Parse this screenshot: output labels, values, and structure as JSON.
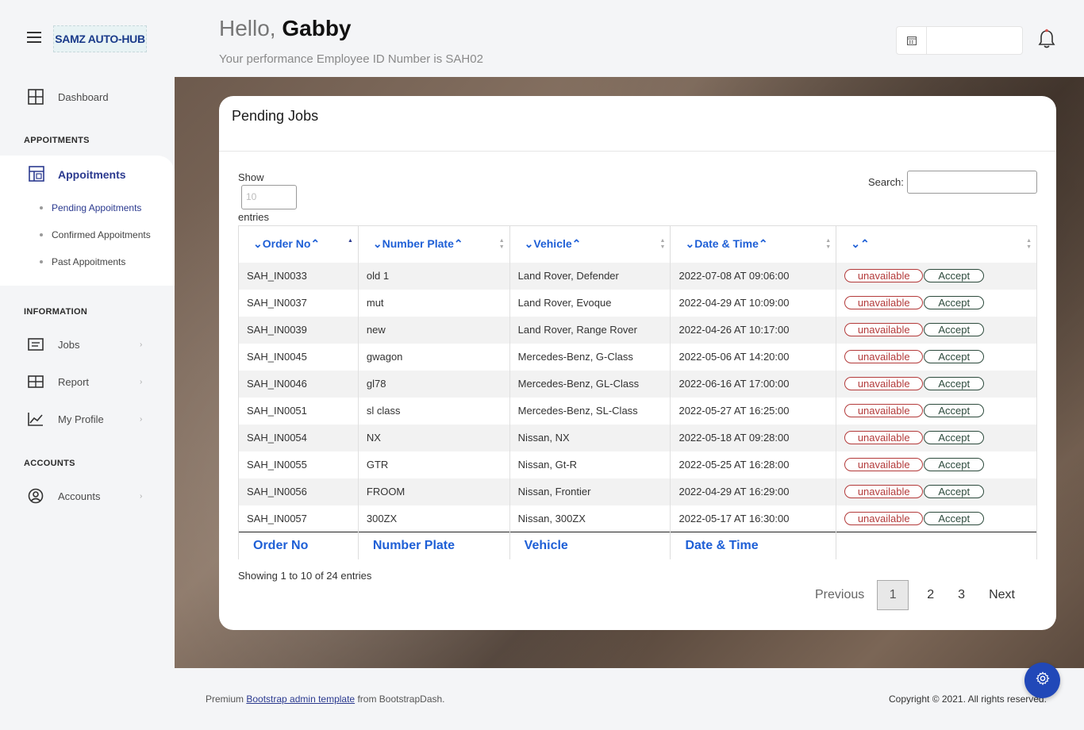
{
  "app": {
    "logo_text": "SAMZ AUTO-HUB"
  },
  "sidebar": {
    "dashboard_label": "Dashboard",
    "section_appointments": "APPOITMENTS",
    "appointments_label": "Appoitments",
    "sub_items": [
      "Pending Appoitments",
      "Confirmed Appoitments",
      "Past Appoitments"
    ],
    "section_information": "INFORMATION",
    "jobs_label": "Jobs",
    "report_label": "Report",
    "profile_label": "My Profile",
    "section_accounts": "ACCOUNTS",
    "accounts_label": "Accounts"
  },
  "header": {
    "greeting_prefix": "Hello,",
    "user_name": "Gabby",
    "subtitle": "Your performance Employee ID Number is SAH02",
    "date_value": ""
  },
  "card": {
    "title": "Pending Jobs",
    "show_label": "Show",
    "entries_placeholder": "10",
    "entries_label": "entries",
    "search_label": "Search:",
    "columns": [
      "Order No",
      "Number Plate",
      "Vehicle",
      "Date & Time",
      ""
    ],
    "footer_columns": [
      "Order No",
      "Number Plate",
      "Vehicle",
      "Date & Time",
      ""
    ],
    "unavailable_label": "unavailable",
    "accept_label": "Accept",
    "rows": [
      [
        "SAH_IN0033",
        "old 1",
        "Land Rover, Defender",
        "2022-07-08 AT 09:06:00"
      ],
      [
        "SAH_IN0037",
        "mut",
        "Land Rover, Evoque",
        "2022-04-29 AT 10:09:00"
      ],
      [
        "SAH_IN0039",
        "new",
        "Land Rover, Range Rover",
        "2022-04-26 AT 10:17:00"
      ],
      [
        "SAH_IN0045",
        "gwagon",
        "Mercedes-Benz, G-Class",
        "2022-05-06 AT 14:20:00"
      ],
      [
        "SAH_IN0046",
        "gl78",
        "Mercedes-Benz, GL-Class",
        "2022-06-16 AT 17:00:00"
      ],
      [
        "SAH_IN0051",
        "sl class",
        "Mercedes-Benz, SL-Class",
        "2022-05-27 AT 16:25:00"
      ],
      [
        "SAH_IN0054",
        "NX",
        "Nissan, NX",
        "2022-05-18 AT 09:28:00"
      ],
      [
        "SAH_IN0055",
        "GTR",
        "Nissan, Gt-R",
        "2022-05-25 AT 16:28:00"
      ],
      [
        "SAH_IN0056",
        "FROOM",
        "Nissan, Frontier",
        "2022-04-29 AT 16:29:00"
      ],
      [
        "SAH_IN0057",
        "300ZX",
        "Nissan, 300ZX",
        "2022-05-17 AT 16:30:00"
      ]
    ],
    "info": "Showing 1 to 10 of 24 entries",
    "pagination": {
      "previous": "Previous",
      "pages": [
        "1",
        "2",
        "3"
      ],
      "current": "1",
      "next": "Next"
    }
  },
  "footer": {
    "left_prefix": "Premium",
    "left_link": "Bootstrap admin template",
    "left_suffix": "from BootstrapDash.",
    "right": "Copyright © 2021. All rights reserved."
  },
  "colors": {
    "accent": "#2b3a8f",
    "link": "#1e5fd6",
    "danger": "#b33a3a",
    "accept": "#2c4a3c",
    "fab": "#2148b8"
  }
}
